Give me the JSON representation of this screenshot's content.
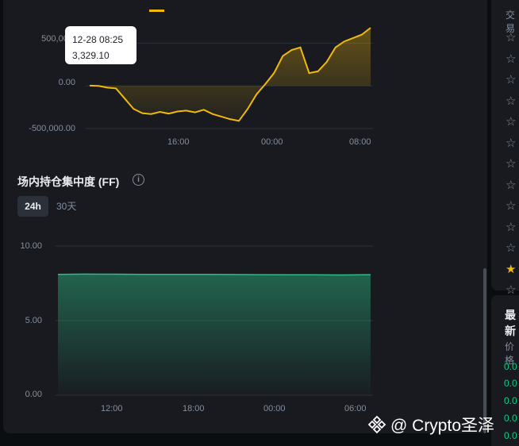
{
  "chart1": {
    "y_labels": [
      "500,000.",
      "0.00",
      "-500,000.00"
    ],
    "x_labels": [
      "16:00",
      "00:00",
      "08:00"
    ],
    "tooltip": {
      "time": "12-28 08:25",
      "value": "3,329.10"
    },
    "line_color": "#f0b90b"
  },
  "section": {
    "title": "场内持仓集中度 (FF)",
    "info_icon": "info-icon",
    "buttons": {
      "h24": "24h",
      "d30": "30天"
    }
  },
  "chart_data": [
    {
      "type": "area",
      "series": [
        {
          "values": [
            3000,
            -500,
            -20000,
            -30000,
            -150000,
            -270000,
            -320000,
            -330000,
            -305000,
            -325000,
            -300000,
            -290000,
            -310000,
            -280000,
            -330000,
            -360000,
            -390000,
            -410000,
            -270000,
            -100000,
            20000,
            150000,
            350000,
            420000,
            450000,
            150000,
            170000,
            280000,
            450000,
            520000,
            560000,
            600000,
            680000
          ]
        }
      ],
      "ylim": [
        -500000,
        550000
      ],
      "x_ticks": [
        "16:00",
        "00:00",
        "08:00"
      ]
    },
    {
      "type": "area",
      "series": [
        {
          "values": [
            8.1,
            8.12,
            8.11,
            8.1,
            8.1,
            8.1,
            8.09,
            8.08,
            8.07,
            8.07,
            8.06,
            8.08
          ]
        }
      ],
      "ylim": [
        0,
        10
      ],
      "y_ticks": [
        "10.00",
        "5.00",
        "0.00"
      ],
      "x_ticks": [
        "12:00",
        "18:00",
        "00:00",
        "06:00"
      ],
      "color": "#2ebd85"
    }
  ],
  "chart2": {
    "y_labels": [
      "10.00",
      "5.00",
      "0.00"
    ],
    "x_labels": [
      "12:00",
      "18:00",
      "00:00",
      "06:00"
    ],
    "line_color": "#2ebd85"
  },
  "right_panel": {
    "header": "交易",
    "title": "最新",
    "column": "价格",
    "values": [
      "0.0",
      "0.0",
      "0.0",
      "0.0",
      "0.0"
    ]
  },
  "watermark": "@ Crypto圣泽"
}
